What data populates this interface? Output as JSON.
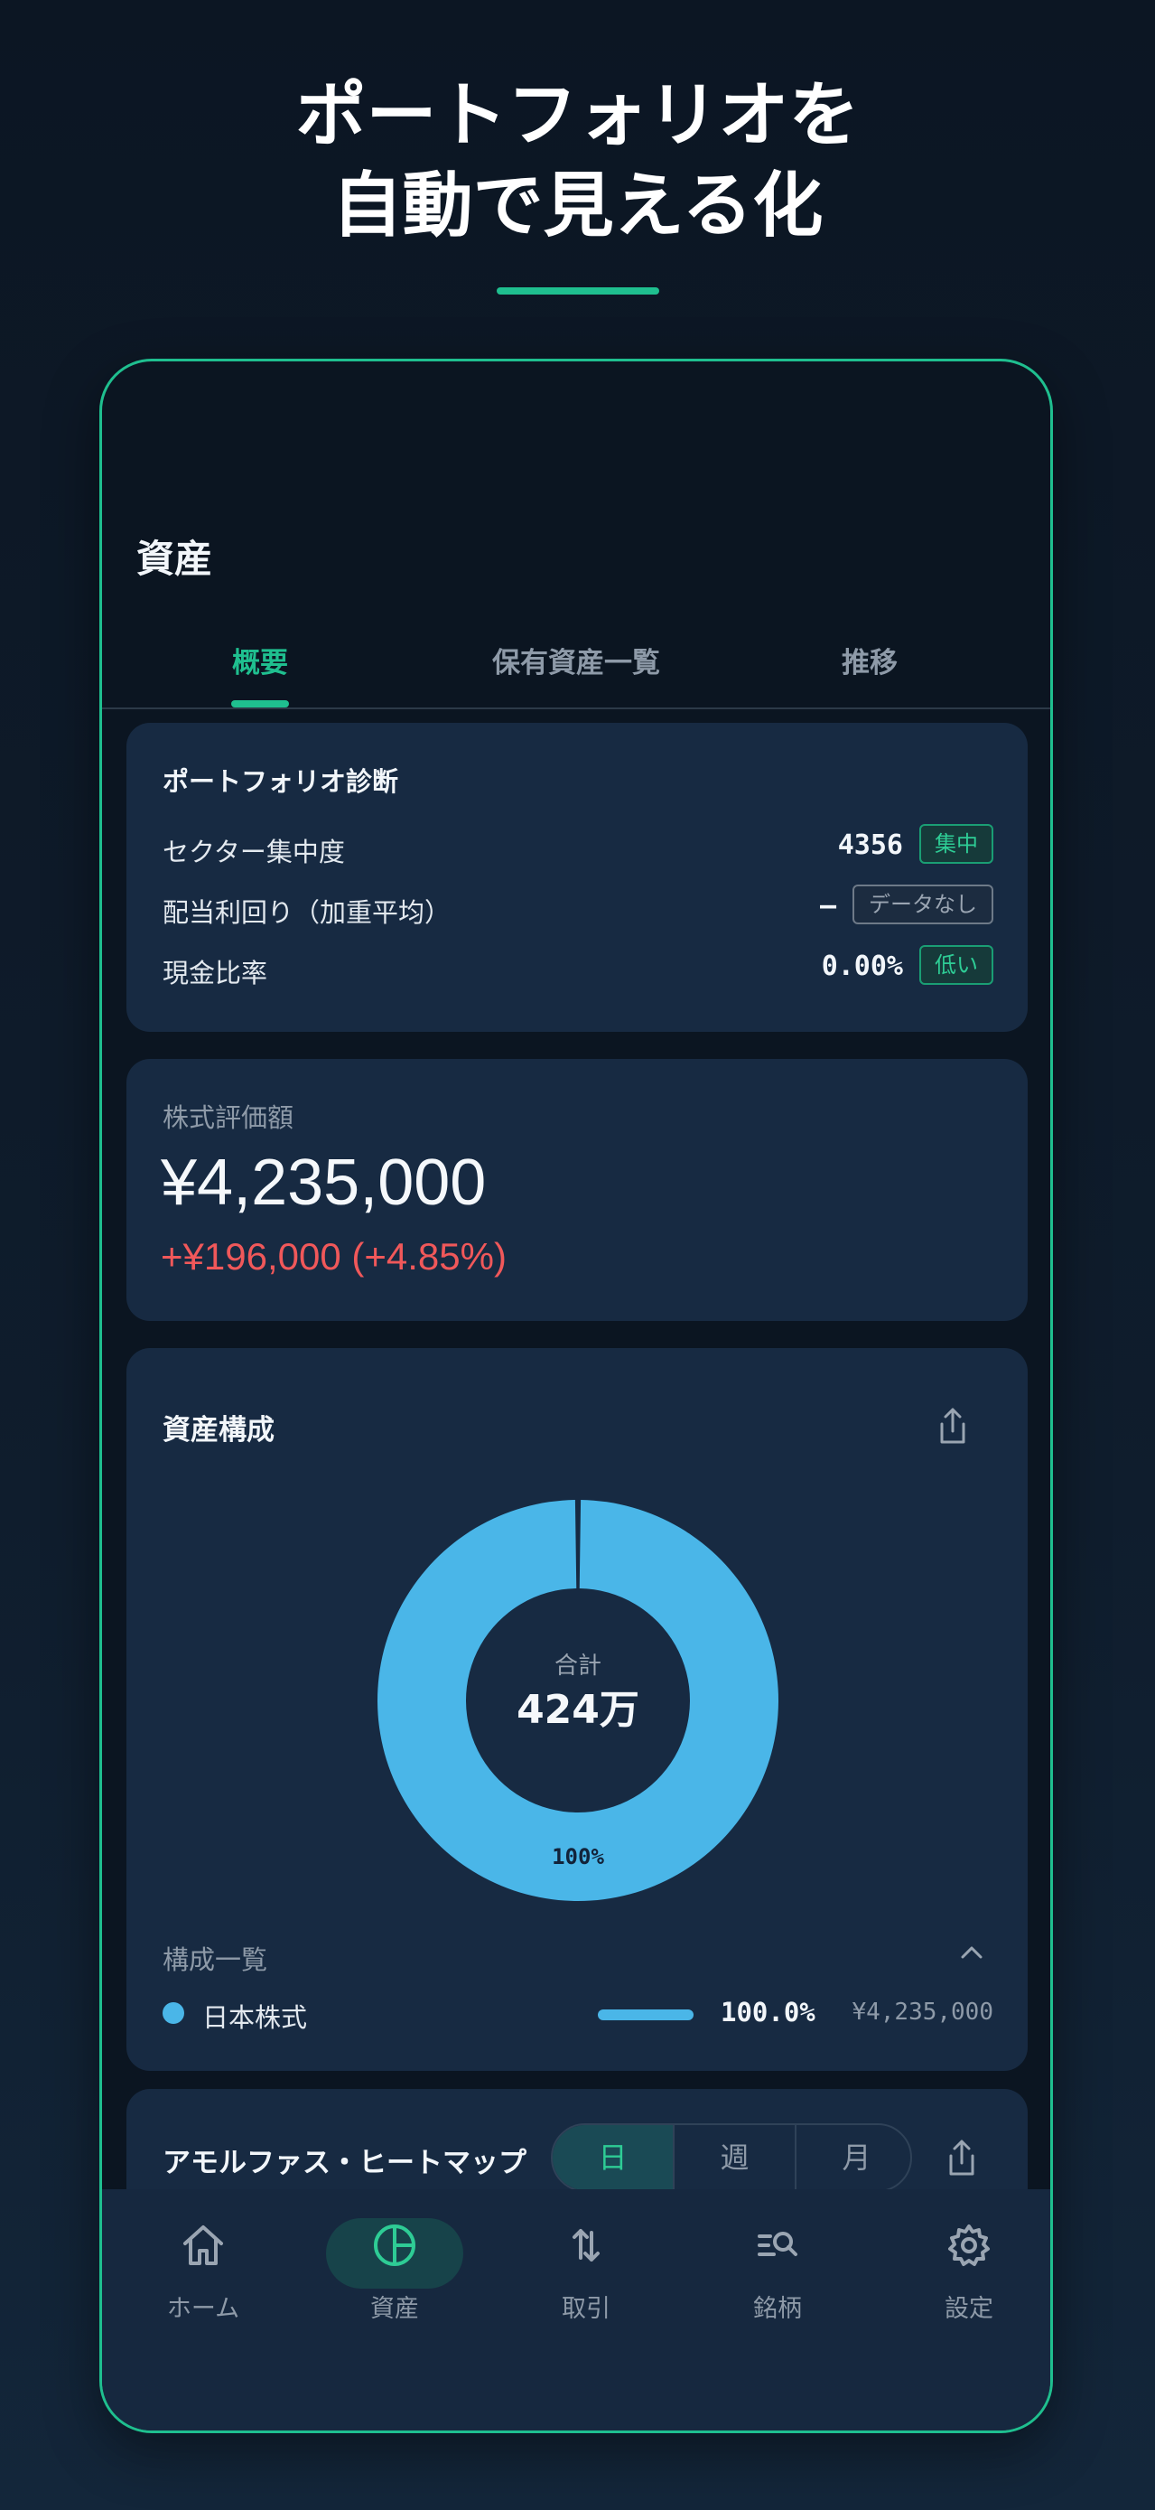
{
  "headline": {
    "line1": "ポートフォリオを",
    "line2": "自動で見える化"
  },
  "page": {
    "title": "資産"
  },
  "tabs": [
    {
      "label": "概要",
      "active": true
    },
    {
      "label": "保有資産一覧",
      "active": false
    },
    {
      "label": "推移",
      "active": false
    }
  ],
  "diagnosis": {
    "title": "ポートフォリオ診断",
    "rows": [
      {
        "label": "セクター集中度",
        "value": "4356",
        "badge": "集中",
        "badge_style": "green"
      },
      {
        "label": "配当利回り（加重平均）",
        "value": "–",
        "badge": "データなし",
        "badge_style": "gray"
      },
      {
        "label": "現金比率",
        "value": "0.00%",
        "badge": "低い",
        "badge_style": "green"
      }
    ]
  },
  "valuation": {
    "label": "株式評価額",
    "amount": "¥4,235,000",
    "change": "+¥196,000 (+4.85%)"
  },
  "composition": {
    "title": "資産構成",
    "total_label": "合計",
    "total_value": "424万",
    "list_title": "構成一覧",
    "items": [
      {
        "name": "日本株式",
        "percent": "100.0%",
        "amount": "¥4,235,000",
        "color": "#4ab6e8"
      }
    ],
    "chart_data": {
      "type": "pie",
      "categories": [
        "日本株式"
      ],
      "values": [
        100
      ],
      "slice_labels": [
        "100%"
      ]
    }
  },
  "heatmap": {
    "title": "アモルファス・ヒートマップ",
    "periods": [
      {
        "label": "日",
        "active": true
      },
      {
        "label": "週",
        "active": false
      },
      {
        "label": "月",
        "active": false
      }
    ]
  },
  "nav": [
    {
      "label": "ホーム",
      "icon": "home-icon",
      "active": false
    },
    {
      "label": "資産",
      "icon": "pie-chart-icon",
      "active": true
    },
    {
      "label": "取引",
      "icon": "transfer-arrows-icon",
      "active": false
    },
    {
      "label": "銘柄",
      "icon": "list-search-icon",
      "active": false
    },
    {
      "label": "設定",
      "icon": "gear-icon",
      "active": false
    }
  ],
  "colors": {
    "accent": "#1fbf8f",
    "chart": "#4ab6e8",
    "negative_change": "#f0585a"
  }
}
